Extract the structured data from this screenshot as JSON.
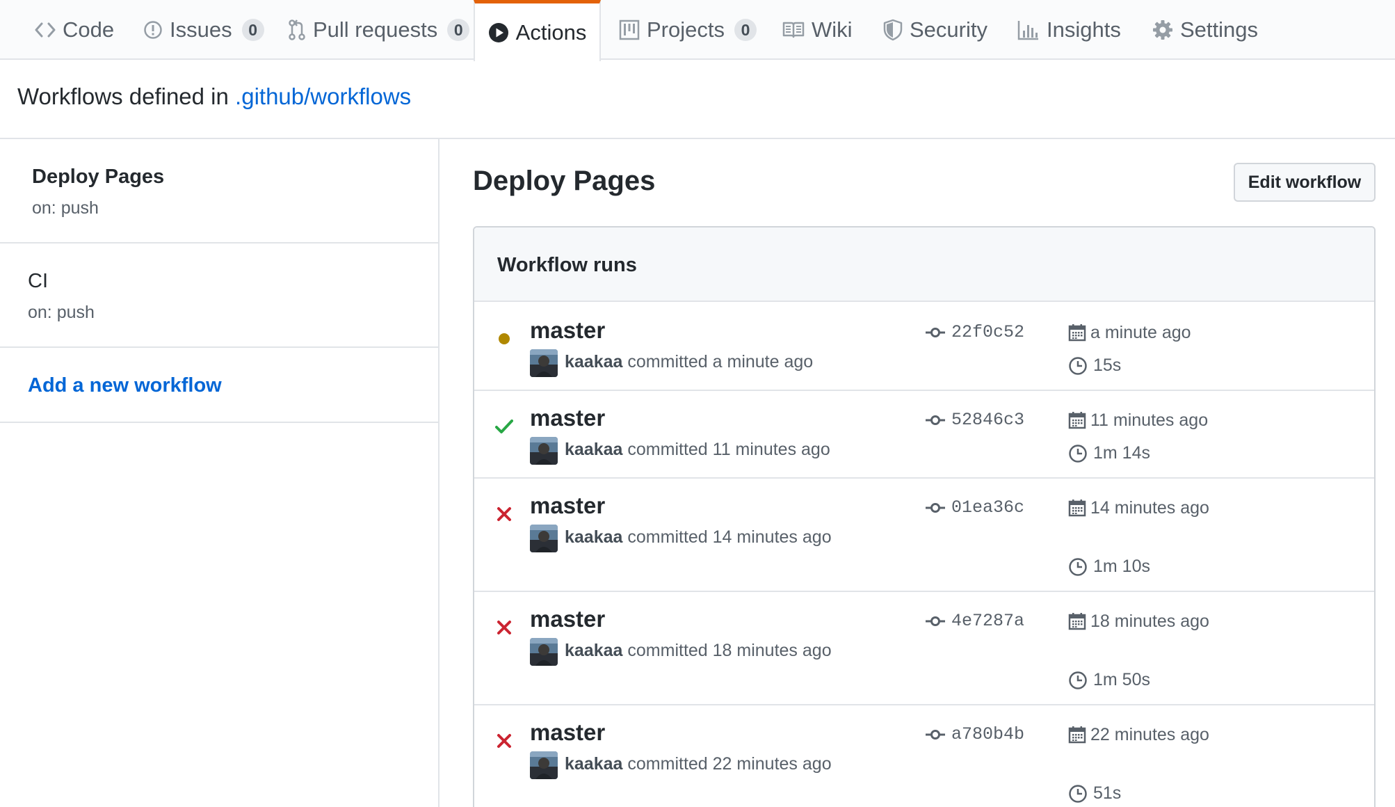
{
  "tabs": [
    {
      "label": "Code",
      "icon": "code-icon"
    },
    {
      "label": "Issues",
      "count": "0",
      "icon": "issue-icon"
    },
    {
      "label": "Pull requests",
      "count": "0",
      "icon": "pull-request-icon"
    },
    {
      "label": "Actions",
      "icon": "play-icon",
      "selected": true
    },
    {
      "label": "Projects",
      "count": "0",
      "icon": "project-icon"
    },
    {
      "label": "Wiki",
      "icon": "book-icon"
    },
    {
      "label": "Security",
      "icon": "shield-icon"
    },
    {
      "label": "Insights",
      "icon": "graph-icon"
    },
    {
      "label": "Settings",
      "icon": "gear-icon"
    }
  ],
  "heading": {
    "prefix": "Workflows defined in",
    "link": ".github/workflows"
  },
  "sidebar": {
    "workflows": [
      {
        "name": "Deploy Pages",
        "trigger": "on: push",
        "selected": true
      },
      {
        "name": "CI",
        "trigger": "on: push",
        "selected": false
      }
    ],
    "add_label": "Add a new workflow"
  },
  "main": {
    "title": "Deploy Pages",
    "edit_label": "Edit workflow",
    "runs_title": "Workflow runs"
  },
  "runs": [
    {
      "status": "in-progress",
      "branch": "master",
      "author": "kaakaa",
      "committed": "committed a minute ago",
      "sha": "22f0c52",
      "when": "a minute ago",
      "duration": "15s"
    },
    {
      "status": "success",
      "branch": "master",
      "author": "kaakaa",
      "committed": "committed 11 minutes ago",
      "sha": "52846c3",
      "when": "11 minutes ago",
      "duration": "1m 14s"
    },
    {
      "status": "failure",
      "branch": "master",
      "author": "kaakaa",
      "committed": "committed 14 minutes ago",
      "sha": "01ea36c",
      "when": "14 minutes ago",
      "duration": "1m 10s"
    },
    {
      "status": "failure",
      "branch": "master",
      "author": "kaakaa",
      "committed": "committed 18 minutes ago",
      "sha": "4e7287a",
      "when": "18 minutes ago",
      "duration": "1m 50s"
    },
    {
      "status": "failure",
      "branch": "master",
      "author": "kaakaa",
      "committed": "committed 22 minutes ago",
      "sha": "a780b4b",
      "when": "22 minutes ago",
      "duration": "51s"
    }
  ],
  "colors": {
    "accent_tab": "#e36209",
    "link": "#0366d6",
    "success": "#28a745",
    "failure": "#cb2431",
    "in_progress": "#b08800"
  }
}
